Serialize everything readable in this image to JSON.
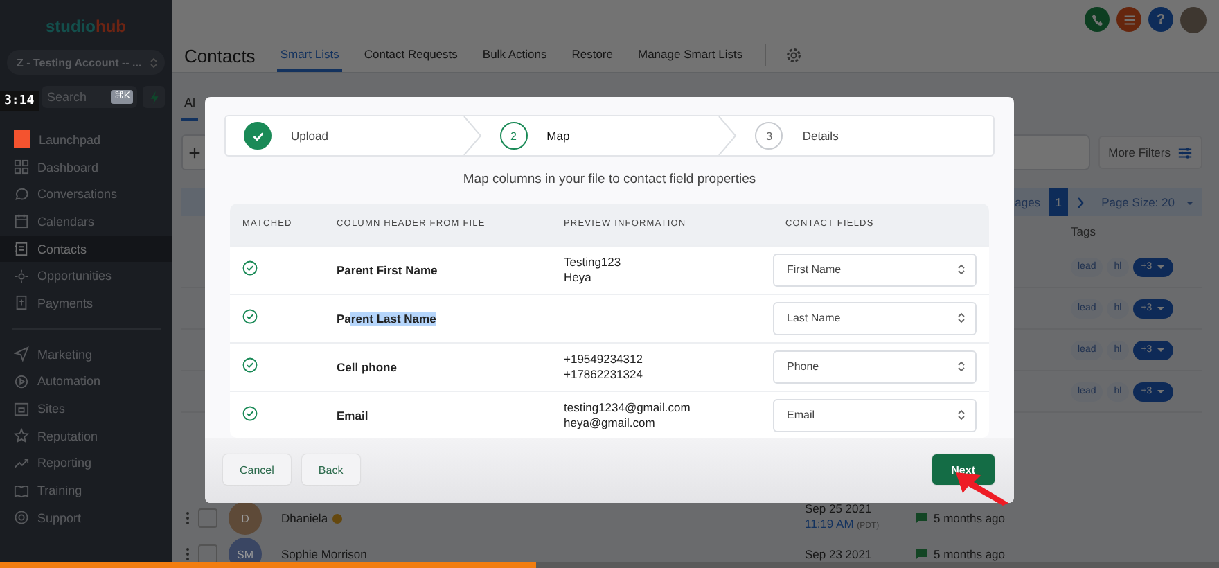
{
  "video": {
    "timestamp": "3:14",
    "level": 0.44
  },
  "sidebar": {
    "logo": [
      "studio",
      "hub"
    ],
    "account": "Z - Testing Account -- ...",
    "search": {
      "placeholder": "Search",
      "shortcut": "⌘K"
    },
    "groups": [
      [
        {
          "label": "Launchpad",
          "selected": false
        },
        {
          "label": "Dashboard",
          "selected": false
        },
        {
          "label": "Conversations",
          "selected": false
        },
        {
          "label": "Calendars",
          "selected": false
        },
        {
          "label": "Contacts",
          "selected": true
        },
        {
          "label": "Opportunities",
          "selected": false
        },
        {
          "label": "Payments",
          "selected": false
        }
      ],
      [
        {
          "label": "Marketing",
          "selected": false
        },
        {
          "label": "Automation",
          "selected": false
        },
        {
          "label": "Sites",
          "selected": false
        },
        {
          "label": "Reputation",
          "selected": false
        },
        {
          "label": "Reporting",
          "selected": false
        },
        {
          "label": "Training",
          "selected": false
        },
        {
          "label": "Support",
          "selected": false
        }
      ]
    ]
  },
  "header": {
    "title": "Contacts",
    "help": "?",
    "tabs": [
      {
        "label": "Smart Lists",
        "selected": true
      },
      {
        "label": "Contact Requests",
        "selected": false
      },
      {
        "label": "Bulk Actions",
        "selected": false
      },
      {
        "label": "Restore",
        "selected": false
      },
      {
        "label": "Manage Smart Lists",
        "selected": false
      }
    ]
  },
  "list": {
    "tab": "Al",
    "more_filters": "More Filters",
    "pagination": {
      "label": "ages",
      "page": "1",
      "page_size": "Page Size: 20"
    },
    "tags_heading": "Tags",
    "tag_rows": [
      [
        {
          "label": "lead",
          "kind": "tag"
        },
        {
          "label": "hl",
          "kind": "tag"
        },
        {
          "label": "+3",
          "kind": "more"
        }
      ],
      [
        {
          "label": "lead",
          "kind": "tag"
        },
        {
          "label": "hl",
          "kind": "tag"
        },
        {
          "label": "+3",
          "kind": "more"
        }
      ],
      [
        {
          "label": "lead",
          "kind": "tag"
        },
        {
          "label": "hl",
          "kind": "tag"
        },
        {
          "label": "+3",
          "kind": "more"
        }
      ],
      [
        {
          "label": "lead",
          "kind": "tag"
        },
        {
          "label": "hl",
          "kind": "tag"
        },
        {
          "label": "+3",
          "kind": "more"
        }
      ]
    ],
    "contacts": [
      {
        "checked": false,
        "initials": "D",
        "name": "Dhaniela",
        "emoji": true,
        "color": "#5e4a38",
        "date": "Sep 25 2021",
        "time": "11:19 AM",
        "zone": "(PDT)",
        "activity": "5 months ago"
      },
      {
        "checked": false,
        "initials": "SM",
        "name": "Sophie Morrison",
        "emoji": false,
        "color": "#3a4663",
        "date": "Sep 23 2021",
        "activity": "5 months ago"
      }
    ]
  },
  "modal": {
    "steps": [
      {
        "label": "Upload",
        "completed": true,
        "selected": false
      },
      {
        "number": "2",
        "label": "Map",
        "completed": false,
        "selected": true
      },
      {
        "number": "3",
        "label": "Details",
        "completed": false,
        "selected": false
      }
    ],
    "subtitle": "Map columns in your file to contact field properties",
    "columns": [
      "MATCHED",
      "COLUMN HEADER FROM FILE",
      "PREVIEW INFORMATION",
      "CONTACT FIELDS"
    ],
    "rows": [
      {
        "matched": true,
        "header": [
          {
            "text": "Parent First Name",
            "highlighted": false
          }
        ],
        "preview": [
          "Testing123",
          "Heya"
        ],
        "field": "First Name"
      },
      {
        "matched": true,
        "header": [
          {
            "text": "Pa",
            "highlighted": false
          },
          {
            "text": "rent Last Name",
            "highlighted": true
          }
        ],
        "field": "Last Name"
      },
      {
        "matched": true,
        "header": [
          {
            "text": "Cell phone",
            "highlighted": false
          }
        ],
        "preview": [
          "+19549234312",
          "+17862231324"
        ],
        "field": "Phone"
      },
      {
        "matched": true,
        "header": [
          {
            "text": "Email",
            "highlighted": false
          }
        ],
        "preview": [
          "testing1234@gmail.com",
          "heya@gmail.com"
        ],
        "field": "Email"
      }
    ],
    "buttons": {
      "cancel": "Cancel",
      "back": "Back",
      "next": "Next"
    }
  }
}
